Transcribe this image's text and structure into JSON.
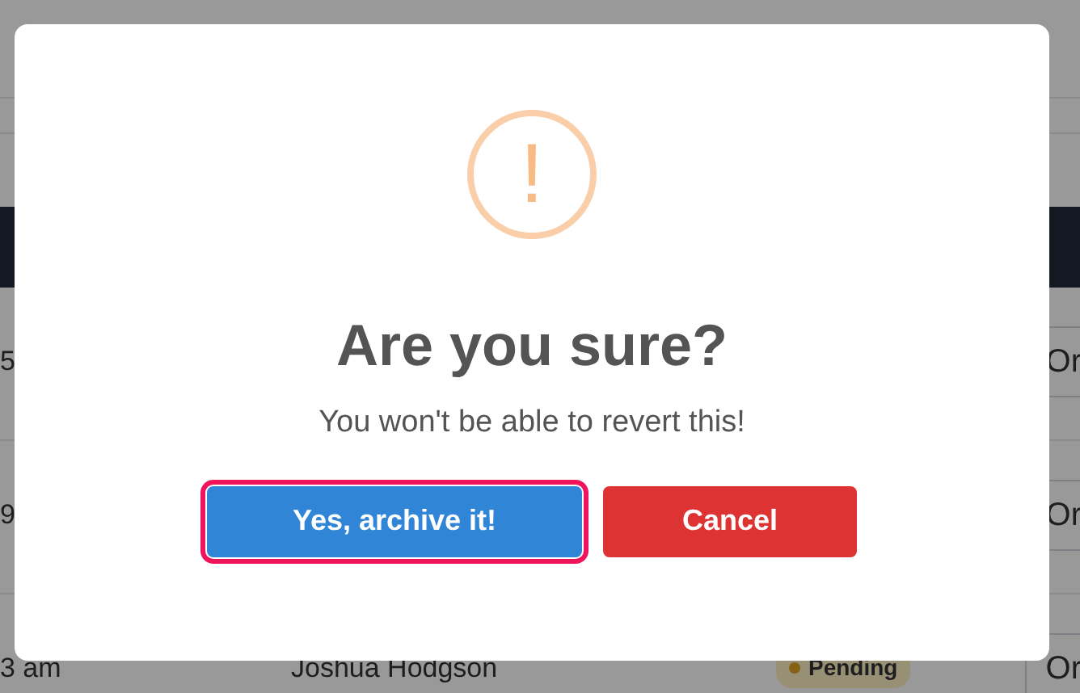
{
  "table": {
    "rows": [
      {
        "time": "5",
        "action": "Or"
      },
      {
        "time": "9",
        "action": "Or"
      },
      {
        "time": "3 am",
        "name": "Joshua Hodgson",
        "status": "Pending",
        "action": "Or"
      }
    ]
  },
  "dialog": {
    "icon": "!",
    "title": "Are you sure?",
    "text": "You won't be able to revert this!",
    "buttons": [
      {
        "label": "Yes, archive it!",
        "kind": "confirm",
        "focused": true
      },
      {
        "label": "Cancel",
        "kind": "cancel",
        "focused": false
      }
    ]
  }
}
